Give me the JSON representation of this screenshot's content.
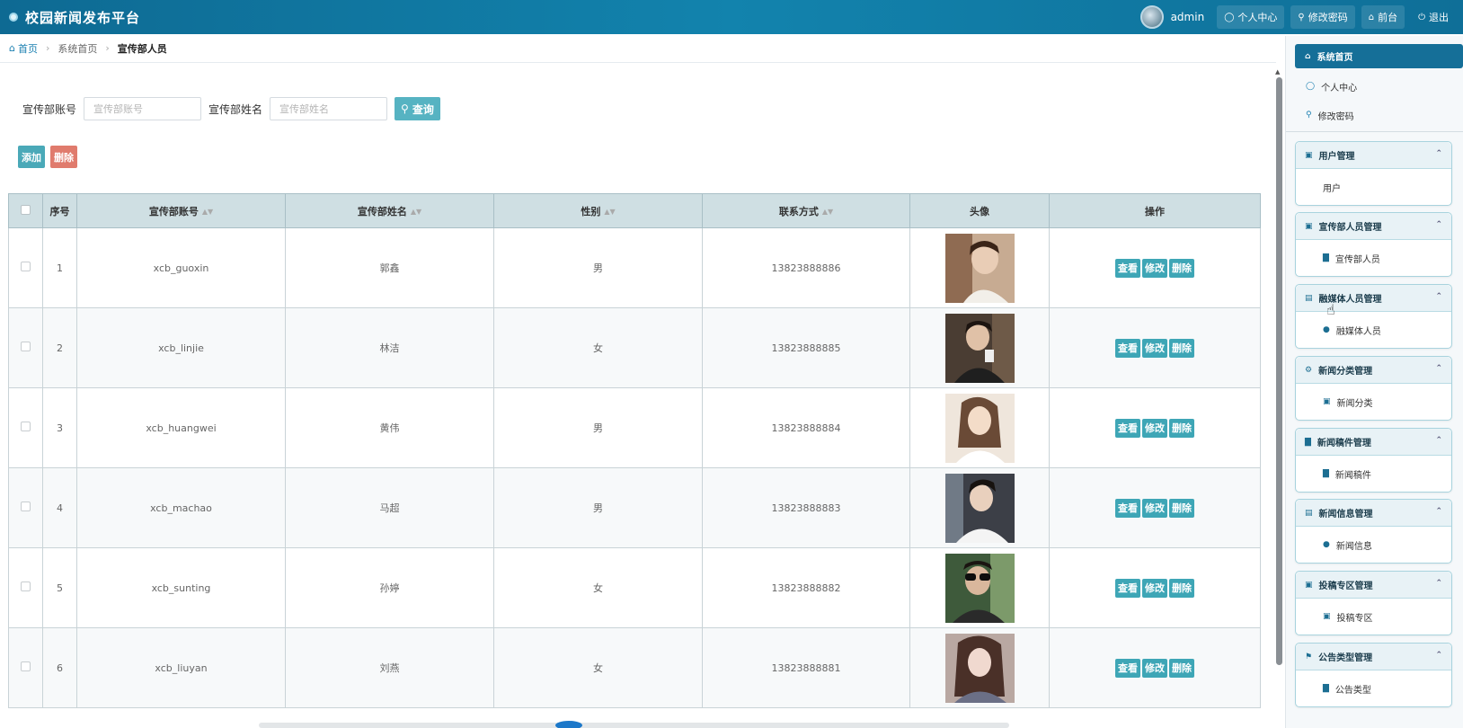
{
  "header": {
    "title": "校园新闻发布平台",
    "username": "admin",
    "buttons": [
      {
        "icon": "user-icon",
        "label": "个人中心"
      },
      {
        "icon": "key-icon",
        "label": "修改密码"
      },
      {
        "icon": "home-icon",
        "label": "前台"
      },
      {
        "icon": "power-icon",
        "label": "退出"
      }
    ]
  },
  "breadcrumb": {
    "home": "首页",
    "level1": "系统首页",
    "current": "宣传部人员"
  },
  "search": {
    "account_label": "宣传部账号",
    "account_placeholder": "宣传部账号",
    "name_label": "宣传部姓名",
    "name_placeholder": "宣传部姓名",
    "query_label": "查询"
  },
  "actions": {
    "add_label": "添加",
    "delete_label": "删除"
  },
  "table": {
    "headers": {
      "index": "序号",
      "account": "宣传部账号",
      "name": "宣传部姓名",
      "gender": "性别",
      "contact": "联系方式",
      "avatar": "头像",
      "ops": "操作"
    },
    "op_labels": {
      "view": "查看",
      "edit": "修改",
      "delete": "删除"
    },
    "rows": [
      {
        "index": "1",
        "account": "xcb_guoxin",
        "name": "郭鑫",
        "gender": "男",
        "contact": "13823888886"
      },
      {
        "index": "2",
        "account": "xcb_linjie",
        "name": "林洁",
        "gender": "女",
        "contact": "13823888885"
      },
      {
        "index": "3",
        "account": "xcb_huangwei",
        "name": "黄伟",
        "gender": "男",
        "contact": "13823888884"
      },
      {
        "index": "4",
        "account": "xcb_machao",
        "name": "马超",
        "gender": "男",
        "contact": "13823888883"
      },
      {
        "index": "5",
        "account": "xcb_sunting",
        "name": "孙婷",
        "gender": "女",
        "contact": "13823888882"
      },
      {
        "index": "6",
        "account": "xcb_liuyan",
        "name": "刘燕",
        "gender": "女",
        "contact": "13823888881"
      }
    ]
  },
  "sidebar": {
    "top_items": [
      {
        "icon": "home-icon",
        "label": "系统首页"
      },
      {
        "icon": "user-icon",
        "label": "个人中心"
      },
      {
        "icon": "key-icon",
        "label": "修改密码"
      }
    ],
    "groups": [
      {
        "icon": "briefcase-icon",
        "title": "用户管理",
        "item_icon": "",
        "item": "用户"
      },
      {
        "icon": "briefcase-icon",
        "title": "宣传部人员管理",
        "item_icon": "bar-chart-icon",
        "item": "宣传部人员"
      },
      {
        "icon": "monitor-icon",
        "title": "融媒体人员管理",
        "item_icon": "bulb-icon",
        "item": "融媒体人员"
      },
      {
        "icon": "gear-icon",
        "title": "新闻分类管理",
        "item_icon": "briefcase-icon",
        "item": "新闻分类"
      },
      {
        "icon": "bar-chart-icon",
        "title": "新闻稿件管理",
        "item_icon": "bar-chart-icon",
        "item": "新闻稿件"
      },
      {
        "icon": "card-icon",
        "title": "新闻信息管理",
        "item_icon": "bulb-icon",
        "item": "新闻信息"
      },
      {
        "icon": "briefcase-icon",
        "title": "投稿专区管理",
        "item_icon": "briefcase-icon",
        "item": "投稿专区"
      },
      {
        "icon": "flag-icon",
        "title": "公告类型管理",
        "item_icon": "bar-chart-icon",
        "item": "公告类型"
      }
    ]
  }
}
